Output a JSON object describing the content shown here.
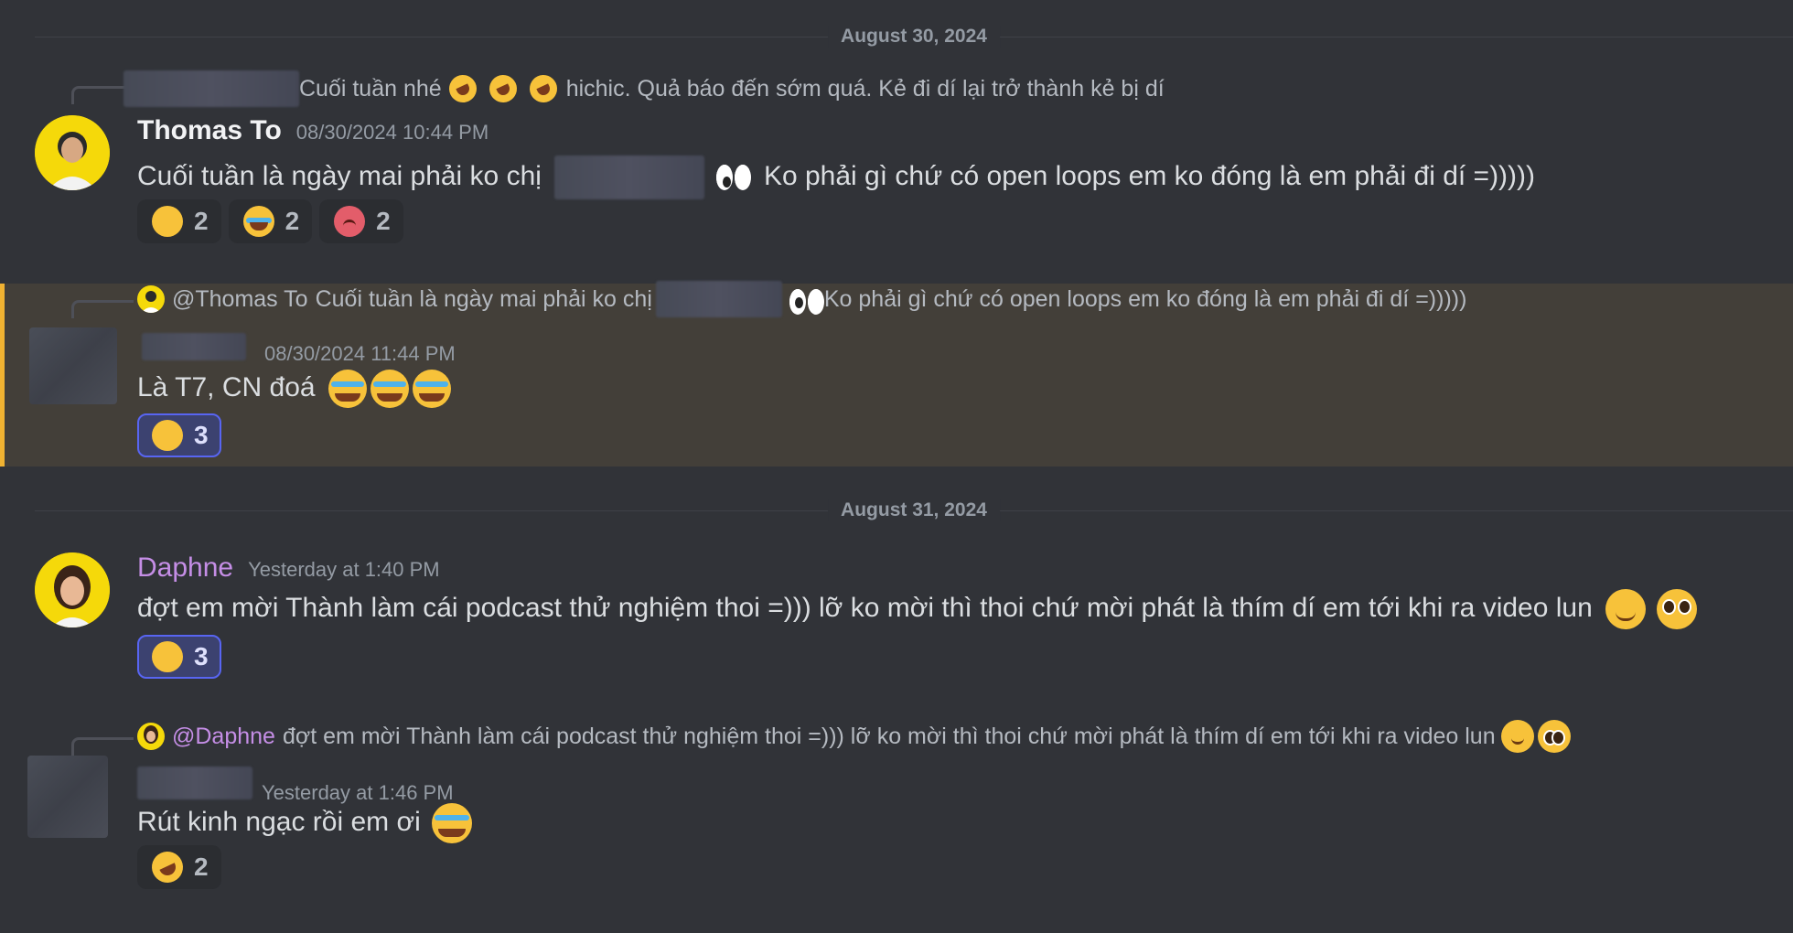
{
  "dividers": [
    {
      "label": "August 30, 2024"
    },
    {
      "label": "August 31, 2024"
    }
  ],
  "messages": [
    {
      "reply": {
        "author": "",
        "text": "Cuối tuần nhé",
        "suffix": "hichic. Quả báo đến sớm quá. Kẻ đi dí lại trở thành kẻ bị dí"
      },
      "author": "Thomas To",
      "timestamp": "08/30/2024 10:44 PM",
      "text_a": "Cuối tuần là ngày mai phải ko chị",
      "text_b": "Ko phải gì chứ có open loops em ko đóng là em phải đi dí =)))))",
      "reactions": [
        {
          "emoji": "joy-emoji",
          "count": "2"
        },
        {
          "emoji": "sob-emoji",
          "count": "2"
        },
        {
          "emoji": "angry-emoji",
          "count": "2"
        }
      ]
    },
    {
      "reply": {
        "author": "@Thomas To",
        "text": "Cuối tuần là ngày mai phải ko chị",
        "suffix": "Ko phải gì chứ có open loops em ko đóng là em phải đi dí =)))))"
      },
      "author": "",
      "timestamp": "08/30/2024 11:44 PM",
      "text": "Là T7, CN đoá",
      "reactions": [
        {
          "emoji": "joy-emoji",
          "count": "3"
        }
      ]
    },
    {
      "author": "Daphne",
      "timestamp": "Yesterday at 1:40 PM",
      "text": "đợt em mời Thành làm cái podcast thử nghiệm thoi =))) lỡ ko mời thì thoi chứ mời phát là thím dí em tới khi ra video lun",
      "reactions": [
        {
          "emoji": "joy-emoji",
          "count": "3"
        }
      ]
    },
    {
      "reply": {
        "author": "@Daphne",
        "text": "đợt em mời Thành làm cái podcast thử nghiệm thoi =))) lỡ ko mời thì thoi chứ mời phát là thím dí em tới khi ra video lun"
      },
      "author": "",
      "timestamp": "Yesterday at 1:46 PM",
      "text": "Rút kinh ngạc rồi em ơi",
      "reactions": [
        {
          "emoji": "rofl-emoji",
          "count": "2"
        }
      ]
    }
  ],
  "colors": {
    "background": "#313338",
    "highlight": "#433f39",
    "highlight_border": "#f0b232",
    "daphne": "#c58ee6",
    "reaction_active": "#5865f2"
  }
}
